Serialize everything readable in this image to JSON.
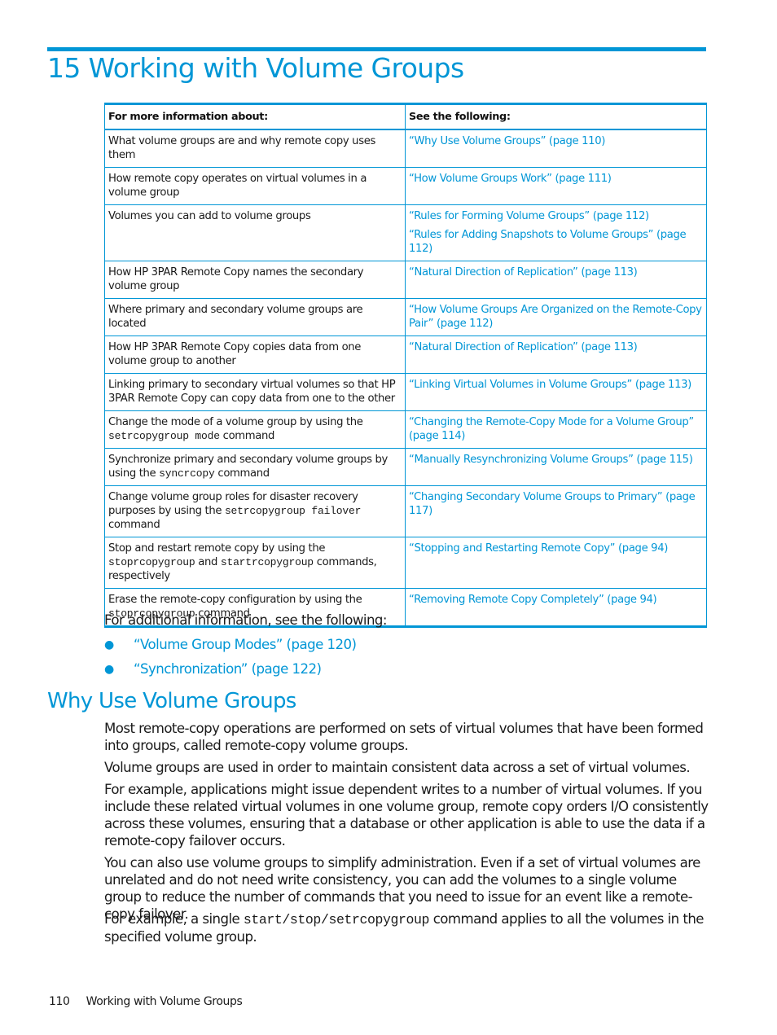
{
  "chapter": {
    "title": "15 Working with Volume Groups"
  },
  "table": {
    "headers": [
      "For more information about:",
      "See the following:"
    ],
    "rows": [
      {
        "topic": [
          "What volume groups are and why remote copy uses them"
        ],
        "links": [
          "“Why Use Volume Groups” (page 110)"
        ]
      },
      {
        "topic": [
          "How remote copy operates on virtual volumes in a volume group"
        ],
        "links": [
          "“How Volume Groups Work” (page 111)"
        ]
      },
      {
        "topic": [
          "Volumes you can add to volume groups"
        ],
        "links": [
          "“Rules for Forming Volume Groups” (page 112)",
          "“Rules for Adding Snapshots to Volume Groups” (page 112)"
        ]
      },
      {
        "topic": [
          "How HP 3PAR Remote Copy names the secondary volume group"
        ],
        "links": [
          "“Natural Direction of Replication” (page 113)"
        ]
      },
      {
        "topic": [
          "Where primary and secondary volume groups are located"
        ],
        "links": [
          "“How Volume Groups Are Organized on the Remote-Copy Pair” (page 112)"
        ]
      },
      {
        "topic": [
          "How HP 3PAR Remote Copy copies data from one volume group to another"
        ],
        "links": [
          "“Natural Direction of Replication” (page 113)"
        ]
      },
      {
        "topic": [
          "Linking primary to secondary virtual volumes so that HP 3PAR Remote Copy can copy data from one to the other"
        ],
        "links": [
          "“Linking Virtual Volumes in Volume Groups” (page 113)"
        ]
      },
      {
        "topic": [
          "Change the mode of a volume group by using the ",
          "setrcopygroup mode",
          " command"
        ],
        "links": [
          "“Changing the Remote-Copy Mode for a Volume Group” (page 114)"
        ]
      },
      {
        "topic": [
          "Synchronize primary and secondary volume groups by using the ",
          "syncrcopy",
          " command"
        ],
        "links": [
          "“Manually Resynchronizing Volume Groups” (page 115)"
        ]
      },
      {
        "topic": [
          "Change volume group roles for disaster recovery purposes by using the ",
          "setrcopygroup failover",
          " command"
        ],
        "links": [
          "“Changing Secondary Volume Groups to Primary” (page 117)"
        ]
      },
      {
        "topic": [
          "Stop and restart remote copy by using the ",
          "stoprcopygroup",
          " and ",
          "startrcopygroup",
          " commands, respectively"
        ],
        "links": [
          "“Stopping and Restarting Remote Copy” (page 94)"
        ]
      },
      {
        "topic": [
          "Erase the remote-copy configuration by using the ",
          "stoprcopygroup",
          " command"
        ],
        "links": [
          "“Removing Remote Copy Completely” (page 94)"
        ]
      }
    ]
  },
  "additional": {
    "intro": "For additional information, see the following:",
    "links": [
      "“Volume Group Modes” (page 120)",
      "“Synchronization” (page 122)"
    ]
  },
  "section": {
    "title": "Why Use Volume Groups",
    "paragraphs": [
      [
        "Most remote-copy operations are performed on sets of virtual volumes that have been formed into groups, called remote-copy volume groups."
      ],
      [
        "Volume groups are used in order to maintain consistent data across a set of virtual volumes."
      ],
      [
        "For example, applications might issue dependent writes to a number of virtual volumes. If you include these related virtual volumes in one volume group, remote copy orders I/O consistently across these volumes, ensuring that a database or other application is able to use the data if a remote-copy failover occurs."
      ],
      [
        "You can also use volume groups to simplify administration. Even if a set of virtual volumes are unrelated and do not need write consistency, you can add the volumes to a single volume group to reduce the number of commands that you need to issue for an event like a remote-copy failover."
      ],
      [
        "For example, a single ",
        "start/stop/setrcopygroup",
        " command applies to all the volumes in the specified volume group."
      ]
    ]
  },
  "footer": {
    "page_number": "110",
    "running_title": "Working with Volume Groups"
  }
}
